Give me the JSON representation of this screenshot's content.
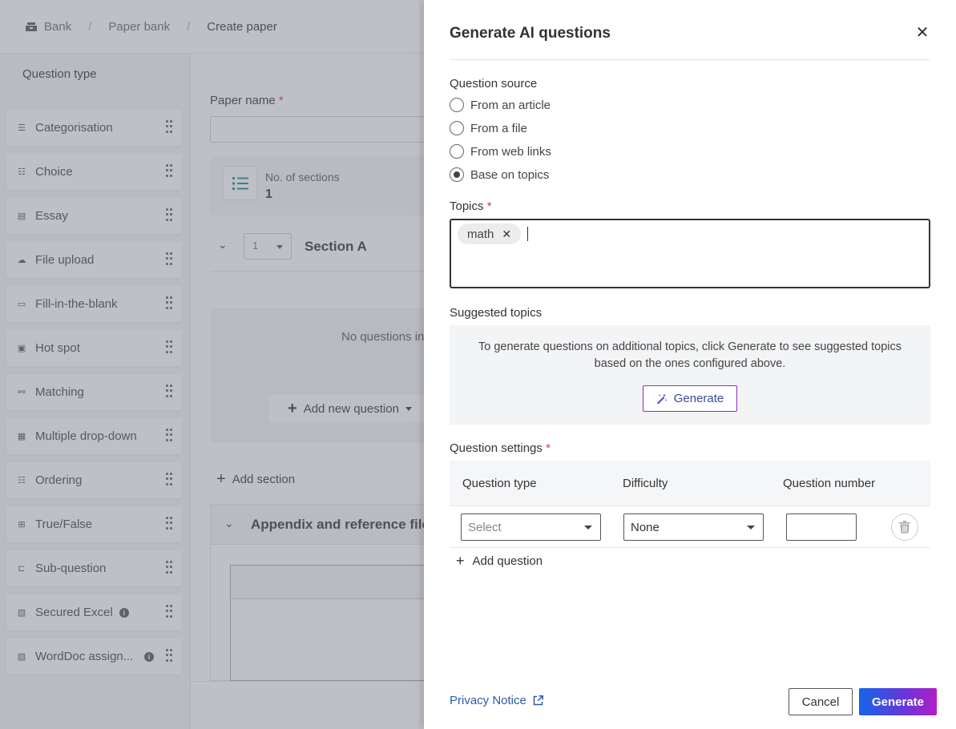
{
  "breadcrumb": {
    "items": [
      "Bank",
      "Paper bank",
      "Create paper"
    ],
    "separator": "/"
  },
  "left_panel": {
    "title": "Question type",
    "items": [
      {
        "label": "Categorisation",
        "icon": "categorisation-icon",
        "info": false
      },
      {
        "label": "Choice",
        "icon": "choice-icon",
        "info": false
      },
      {
        "label": "Essay",
        "icon": "essay-icon",
        "info": false
      },
      {
        "label": "File upload",
        "icon": "file-upload-icon",
        "info": false
      },
      {
        "label": "Fill-in-the-blank",
        "icon": "fill-blank-icon",
        "info": false
      },
      {
        "label": "Hot spot",
        "icon": "hot-spot-icon",
        "info": false
      },
      {
        "label": "Matching",
        "icon": "matching-icon",
        "info": false
      },
      {
        "label": "Multiple drop-down",
        "icon": "dropdown-icon",
        "info": false
      },
      {
        "label": "Ordering",
        "icon": "ordering-icon",
        "info": false
      },
      {
        "label": "True/False",
        "icon": "true-false-icon",
        "info": false
      },
      {
        "label": "Sub-question",
        "icon": "sub-question-icon",
        "info": false
      },
      {
        "label": "Secured Excel",
        "icon": "excel-icon",
        "info": true
      },
      {
        "label": "WordDoc assign...",
        "icon": "word-icon",
        "info": true
      }
    ]
  },
  "main": {
    "paper_name_label": "Paper name",
    "required_mark": "*",
    "sections_label": "No. of sections",
    "sections_value": "1",
    "section_number": "1",
    "section_title": "Section A",
    "no_questions_text": "No questions in",
    "add_new_question": "Add new question",
    "add_section": "Add section",
    "appendix_title": "Appendix and reference file"
  },
  "drawer": {
    "title": "Generate AI questions",
    "question_source_label": "Question source",
    "sources": [
      {
        "label": "From an article",
        "checked": false
      },
      {
        "label": "From a file",
        "checked": false
      },
      {
        "label": "From web links",
        "checked": false
      },
      {
        "label": "Base on topics",
        "checked": true
      }
    ],
    "topics_label": "Topics",
    "topics": [
      "math"
    ],
    "suggested_topics_label": "Suggested topics",
    "suggested_text": "To generate questions on additional topics, click Generate to see suggested topics based on the ones configured above.",
    "suggest_generate_label": "Generate",
    "question_settings_label": "Question settings",
    "columns": [
      "Question type",
      "Difficulty",
      "Question number"
    ],
    "row": {
      "question_type_placeholder": "Select",
      "difficulty_value": "None",
      "question_number": ""
    },
    "add_question_label": "Add question",
    "privacy_notice": "Privacy Notice",
    "cancel_label": "Cancel",
    "generate_label": "Generate"
  },
  "colors": {
    "accent_blue": "#1565e8",
    "accent_purple": "#b31ec6",
    "required_red": "#d9363e",
    "link_blue": "#2d5ca8"
  }
}
